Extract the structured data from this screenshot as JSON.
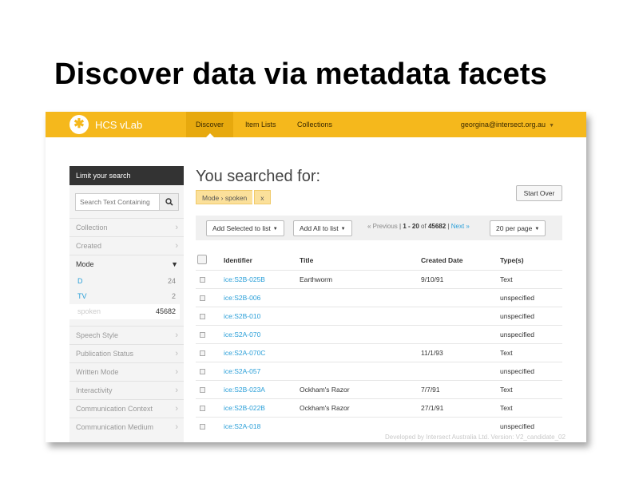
{
  "slide": {
    "title": "Discover data via metadata facets"
  },
  "navbar": {
    "brand": "HCS vLab",
    "items": [
      {
        "label": "Discover",
        "active": true
      },
      {
        "label": "Item Lists",
        "active": false
      },
      {
        "label": "Collections",
        "active": false
      }
    ],
    "user": "georgina@intersect.org.au"
  },
  "sidebar": {
    "heading": "Limit your search",
    "search_placeholder": "Search Text Containing",
    "facets_before": [
      "Collection",
      "Created"
    ],
    "open_facet": {
      "label": "Mode",
      "values": [
        {
          "label": "D",
          "count": "24"
        },
        {
          "label": "TV",
          "count": "2"
        },
        {
          "label": "spoken",
          "count": "45682",
          "selected": true
        }
      ]
    },
    "facets_after": [
      "Speech Style",
      "Publication Status",
      "Written Mode",
      "Interactivity",
      "Communication Context",
      "Communication Medium"
    ]
  },
  "main": {
    "heading": "You searched for:",
    "constraint": {
      "field": "Mode",
      "separator": "›",
      "value": "spoken",
      "remove": "x"
    },
    "start_over": "Start Over",
    "toolbar": {
      "add_selected": "Add Selected to list",
      "add_all": "Add All to list",
      "pager": {
        "previous": "« Previous",
        "sep": "|",
        "range": "1 - 20",
        "of": "of",
        "total": "45682",
        "next": "Next »"
      },
      "per_page": "20 per page"
    },
    "table": {
      "columns": [
        "Identifier",
        "Title",
        "Created Date",
        "Type(s)"
      ],
      "rows": [
        {
          "id": "ice:S2B-025B",
          "title": "Earthworm",
          "date": "9/10/91",
          "type": "Text"
        },
        {
          "id": "ice:S2B-006",
          "title": "",
          "date": "",
          "type": "unspecified"
        },
        {
          "id": "ice:S2B-010",
          "title": "",
          "date": "",
          "type": "unspecified"
        },
        {
          "id": "ice:S2A-070",
          "title": "",
          "date": "",
          "type": "unspecified"
        },
        {
          "id": "ice:S2A-070C",
          "title": "",
          "date": "11/1/93",
          "type": "Text"
        },
        {
          "id": "ice:S2A-057",
          "title": "",
          "date": "",
          "type": "unspecified"
        },
        {
          "id": "ice:S2B-023A",
          "title": "Ockham's Razor",
          "date": "7/7/91",
          "type": "Text"
        },
        {
          "id": "ice:S2B-022B",
          "title": "Ockham's Razor",
          "date": "27/1/91",
          "type": "Text"
        },
        {
          "id": "ice:S2A-018",
          "title": "",
          "date": "",
          "type": "unspecified"
        }
      ]
    },
    "footer": "Developed by Intersect Australia Ltd. Version: V2_candidate_02"
  },
  "colors": {
    "navbar": "#f5b81c",
    "link": "#2a9fd8",
    "sidebar_header": "#333333",
    "constraint": "#fbe09a"
  }
}
